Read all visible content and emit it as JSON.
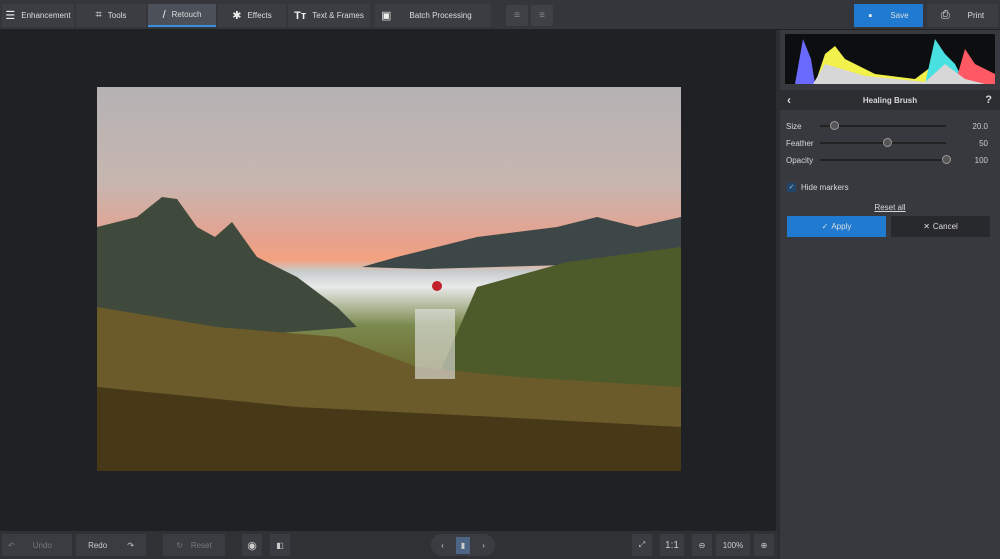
{
  "toolbar": {
    "tabs": [
      {
        "label": "Enhancement",
        "icon": "sliders-icon"
      },
      {
        "label": "Tools",
        "icon": "crop-icon"
      },
      {
        "label": "Retouch",
        "icon": "brush-icon",
        "active": true
      },
      {
        "label": "Effects",
        "icon": "magic-wand-icon"
      },
      {
        "label": "Text & Frames",
        "icon": "text-icon"
      }
    ],
    "batch": "Batch Processing",
    "save": "Save",
    "print": "Print"
  },
  "panel": {
    "title": "Healing Brush",
    "help": "?",
    "sliders": [
      {
        "label": "Size",
        "value": "20.0",
        "fraction": 0.05
      },
      {
        "label": "Feather",
        "value": "50",
        "fraction": 0.5
      },
      {
        "label": "Opacity",
        "value": "100",
        "fraction": 1.0
      }
    ],
    "hide_markers": "Hide markers",
    "hide_markers_checked": true,
    "reset_all": "Reset all",
    "apply": "Apply",
    "cancel": "Cancel"
  },
  "bottom": {
    "undo": "Undo",
    "redo": "Redo",
    "reset": "Reset",
    "ratio": "1:1",
    "zoom": "100%"
  },
  "colors": {
    "accent": "#1f7ad0",
    "background": "#2b2d31"
  }
}
